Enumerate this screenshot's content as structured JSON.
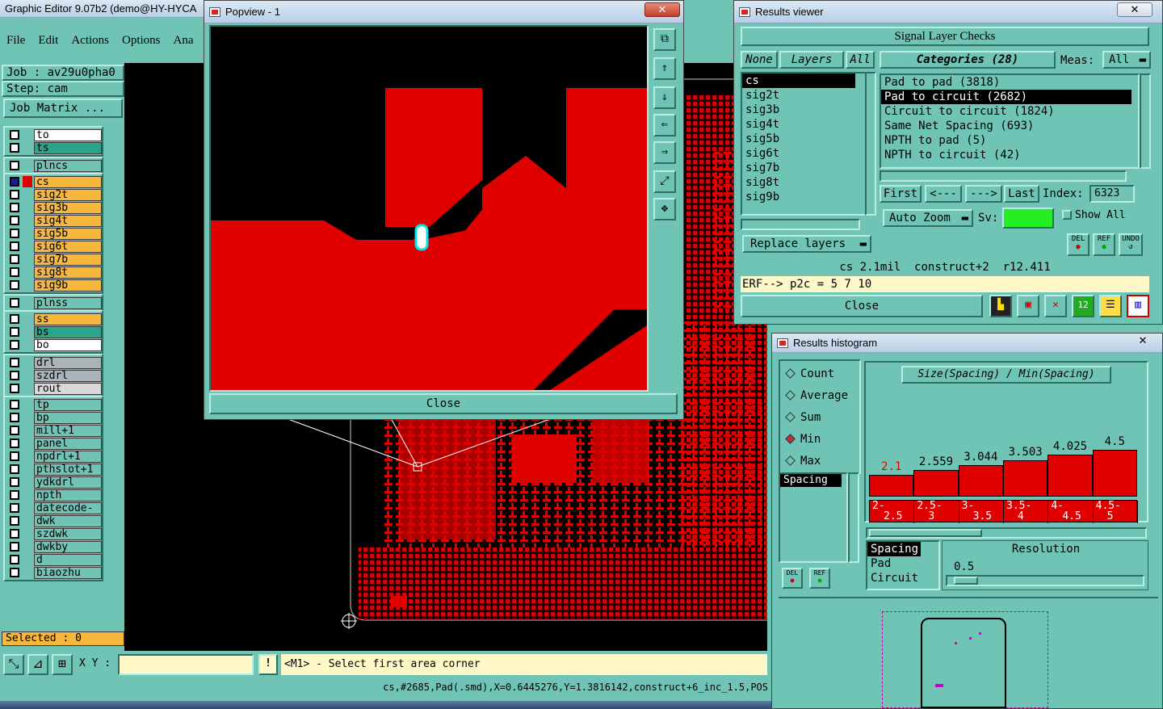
{
  "main": {
    "title": "Graphic Editor 9.07b2 (demo@HY-HYCA",
    "menu": [
      "File",
      "Edit",
      "Actions",
      "Options",
      "Ana"
    ],
    "job": "Job : av29u0pha0",
    "step": "Step: cam",
    "job_matrix": "Job Matrix ...",
    "layers_group1": [
      {
        "name": "to",
        "color": "#ffffff"
      },
      {
        "name": "ts",
        "color": "#2aa58a"
      }
    ],
    "layers_group2": [
      {
        "name": "plncs",
        "color": "#6fc4b6"
      }
    ],
    "layers_group3": [
      {
        "name": "cs",
        "color": "#f6b73c"
      },
      {
        "name": "sig2t",
        "color": "#f6b73c"
      },
      {
        "name": "sig3b",
        "color": "#f6b73c"
      },
      {
        "name": "sig4t",
        "color": "#f6b73c"
      },
      {
        "name": "sig5b",
        "color": "#f6b73c"
      },
      {
        "name": "sig6t",
        "color": "#f6b73c"
      },
      {
        "name": "sig7b",
        "color": "#f6b73c"
      },
      {
        "name": "sig8t",
        "color": "#f6b73c"
      },
      {
        "name": "sig9b",
        "color": "#f6b73c"
      }
    ],
    "layers_group4": [
      {
        "name": "plnss",
        "color": "#6fc4b6"
      }
    ],
    "layers_group5": [
      {
        "name": "ss",
        "color": "#f6b73c"
      },
      {
        "name": "bs",
        "color": "#2aa58a"
      },
      {
        "name": "bo",
        "color": "#ffffff"
      }
    ],
    "layers_group6": [
      {
        "name": "drl",
        "color": "#a8b4b8"
      },
      {
        "name": "szdrl",
        "color": "#a8b4b8"
      },
      {
        "name": "rout",
        "color": "#d8d8d8"
      }
    ],
    "layers_group7": [
      {
        "name": "tp",
        "color": "#6fc4b6"
      },
      {
        "name": "bp",
        "color": "#6fc4b6"
      },
      {
        "name": "mill+1",
        "color": "#6fc4b6"
      },
      {
        "name": "panel",
        "color": "#6fc4b6"
      },
      {
        "name": "npdrl+1",
        "color": "#6fc4b6"
      },
      {
        "name": "pthslot+1",
        "color": "#6fc4b6"
      },
      {
        "name": "ydkdrl",
        "color": "#6fc4b6"
      },
      {
        "name": "npth",
        "color": "#6fc4b6"
      },
      {
        "name": "datecode-ptc",
        "color": "#6fc4b6"
      },
      {
        "name": "dwk",
        "color": "#6fc4b6"
      },
      {
        "name": "szdwk",
        "color": "#6fc4b6"
      },
      {
        "name": "dwkby",
        "color": "#6fc4b6"
      },
      {
        "name": "d",
        "color": "#6fc4b6"
      },
      {
        "name": "biaozhu",
        "color": "#6fc4b6"
      }
    ],
    "selected": "Selected : 0",
    "xy_label": "X Y :",
    "xy_value": "",
    "prompt": "<M1> - Select first area corner",
    "coord_line": "cs,#2685,Pad(.smd),X=0.6445276,Y=1.3816142,construct+6_inc_1.5,POS"
  },
  "popview": {
    "title": "Popview - 1",
    "close": "Close"
  },
  "results": {
    "title": "Results viewer",
    "heading": "Signal Layer Checks",
    "none": "None",
    "layers": "Layers",
    "all": "All",
    "categories": "Categories (28)",
    "meas_label": "Meas:",
    "meas_value": "All",
    "layer_list": [
      "cs",
      "sig2t",
      "sig3b",
      "sig4t",
      "sig5b",
      "sig6t",
      "sig7b",
      "sig8t",
      "sig9b"
    ],
    "category_list": [
      "Pad to pad (3818)",
      "Pad to circuit (2682)",
      "Circuit to circuit (1824)",
      "Same Net Spacing (693)",
      "NPTH to pad (5)",
      "NPTH to circuit (42)"
    ],
    "first": "First",
    "prev": "<---",
    "next": "--->",
    "last": "Last",
    "index_label": "Index:",
    "index_value": "6323",
    "auto_zoom": "Auto Zoom",
    "sv_label": "Sv:",
    "show_all": "Show All",
    "replace_layers": "Replace layers",
    "del": "DEL",
    "ref": "REF",
    "undo": "UNDO",
    "info_line": "cs 2.1mil  construct+2  r12.411",
    "erf_line": "ERF--> p2c = 5 7 10",
    "close": "Close"
  },
  "histogram": {
    "title": "Results histogram",
    "modes": [
      "Count",
      "Average",
      "Sum",
      "Min",
      "Max"
    ],
    "selected_mode": "Min",
    "list_item": "Spacing",
    "del": "DEL",
    "ref": "REF",
    "chart_title": "Size(Spacing) / Min(Spacing)",
    "resolution_label": "Resolution",
    "resolution_value": "0.5",
    "measure_list": [
      "Spacing",
      "Pad",
      "Circuit"
    ]
  },
  "chart_data": {
    "type": "bar",
    "title": "Size(Spacing) / Min(Spacing)",
    "categories": [
      "2-2.5",
      "2.5-3",
      "3-3.5",
      "3.5-4",
      "4-4.5",
      "4.5-5"
    ],
    "category_lines": [
      [
        "2-",
        "2.5"
      ],
      [
        "2.5-",
        "3"
      ],
      [
        "3-",
        "3.5"
      ],
      [
        "3.5-",
        "4"
      ],
      [
        "4-",
        "4.5"
      ],
      [
        "4.5-",
        "5"
      ]
    ],
    "values": [
      2.1,
      2.559,
      3.044,
      3.503,
      4.025,
      4.5
    ],
    "value_labels": [
      "2.1",
      "2.559",
      "3.044",
      "3.503",
      "4.025",
      "4.5"
    ],
    "ylim": [
      0,
      4.5
    ],
    "colors": {
      "bar": "#e00000",
      "first_label": "#e00000"
    }
  }
}
